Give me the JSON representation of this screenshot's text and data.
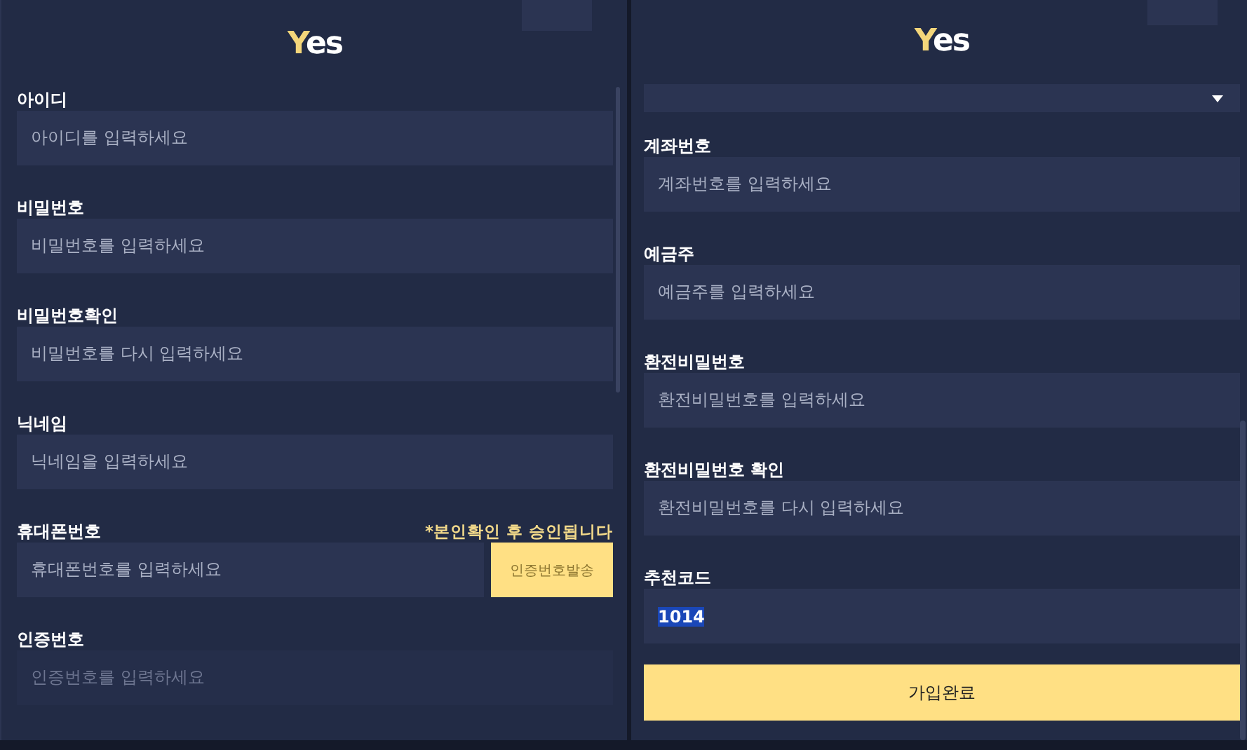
{
  "panels": [
    {
      "logo": {
        "accent": "Y",
        "rest": "es"
      },
      "select_cut": false,
      "fields": [
        {
          "kind": "text",
          "label": "아이디",
          "placeholder": "아이디를 입력하세요",
          "disabled": false
        },
        {
          "kind": "text",
          "label": "비밀번호",
          "placeholder": "비밀번호를 입력하세요",
          "disabled": false
        },
        {
          "kind": "text",
          "label": "비밀번호확인",
          "placeholder": "비밀번호를 다시 입력하세요",
          "disabled": false
        },
        {
          "kind": "text",
          "label": "닉네임",
          "placeholder": "닉네임을 입력하세요",
          "disabled": false
        },
        {
          "kind": "phone",
          "label": "휴대폰번호",
          "note": "*본인확인 후 승인됩니다",
          "placeholder": "휴대폰번호를 입력하세요",
          "button": "인증번호발송",
          "disabled": false
        },
        {
          "kind": "text",
          "label": "인증번호",
          "placeholder": "인증번호를 입력하세요",
          "disabled": true
        }
      ]
    },
    {
      "logo": {
        "accent": "Y",
        "rest": "es"
      },
      "select_cut": true,
      "fields": [
        {
          "kind": "text",
          "label": "계좌번호",
          "placeholder": "계좌번호를 입력하세요",
          "disabled": false
        },
        {
          "kind": "text",
          "label": "예금주",
          "placeholder": "예금주를 입력하세요",
          "disabled": false
        },
        {
          "kind": "text",
          "label": "환전비밀번호",
          "placeholder": "환전비밀번호를 입력하세요",
          "disabled": false
        },
        {
          "kind": "text",
          "label": "환전비밀번호 확인",
          "placeholder": "환전비밀번호를 다시 입력하세요",
          "disabled": false
        },
        {
          "kind": "text",
          "label": "추천코드",
          "value": {
            "text": "1014",
            "selected": true
          },
          "disabled": false
        }
      ],
      "submit": "가입완료"
    }
  ]
}
